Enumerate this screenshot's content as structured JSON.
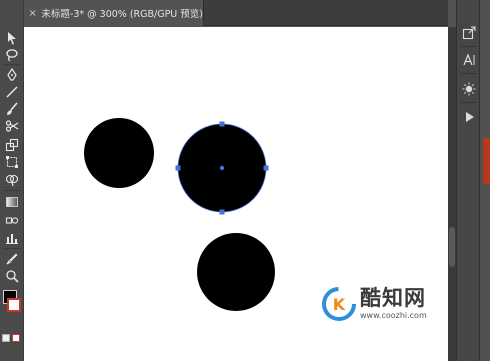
{
  "document": {
    "tab_close": "×",
    "tab_title": "未标题-3* @ 300% (RGB/GPU 预览)"
  },
  "tools": [
    {
      "name": "selection-tool-icon",
      "glyph": "▶"
    },
    {
      "name": "lasso-tool-icon",
      "glyph": "⟳"
    },
    {
      "name": "pen-tool-icon",
      "glyph": "✒"
    },
    {
      "name": "line-tool-icon",
      "glyph": "╱"
    },
    {
      "name": "paintbrush-tool-icon",
      "glyph": "🖌"
    },
    {
      "name": "scissors-tool-icon",
      "glyph": "✂"
    },
    {
      "name": "scale-tool-icon",
      "glyph": "⧉"
    },
    {
      "name": "free-transform-tool-icon",
      "glyph": "⛶"
    },
    {
      "name": "shape-builder-tool-icon",
      "glyph": "⬡"
    },
    {
      "name": "gradient-tool-icon",
      "glyph": "▦"
    },
    {
      "name": "blend-tool-icon",
      "glyph": "◎"
    },
    {
      "name": "symbol-sprayer-tool-icon",
      "glyph": "⁂"
    },
    {
      "name": "column-graph-tool-icon",
      "glyph": "▥"
    },
    {
      "name": "eyedropper-tool-icon",
      "glyph": "⚲"
    },
    {
      "name": "zoom-tool-icon",
      "glyph": "⌕"
    }
  ],
  "dock": [
    {
      "name": "export-panel-icon",
      "glyph": "⇱"
    },
    {
      "name": "character-panel-icon",
      "glyph": "A|"
    },
    {
      "name": "appearance-panel-icon",
      "glyph": "✺"
    },
    {
      "name": "actions-panel-icon",
      "glyph": "▶"
    }
  ],
  "watermark": {
    "name": "酷知网",
    "url": "www.coozhi.com"
  },
  "colors": {
    "canvas": "#ffffff",
    "shape_fill": "#000000",
    "selection": "#4a6fd6"
  }
}
